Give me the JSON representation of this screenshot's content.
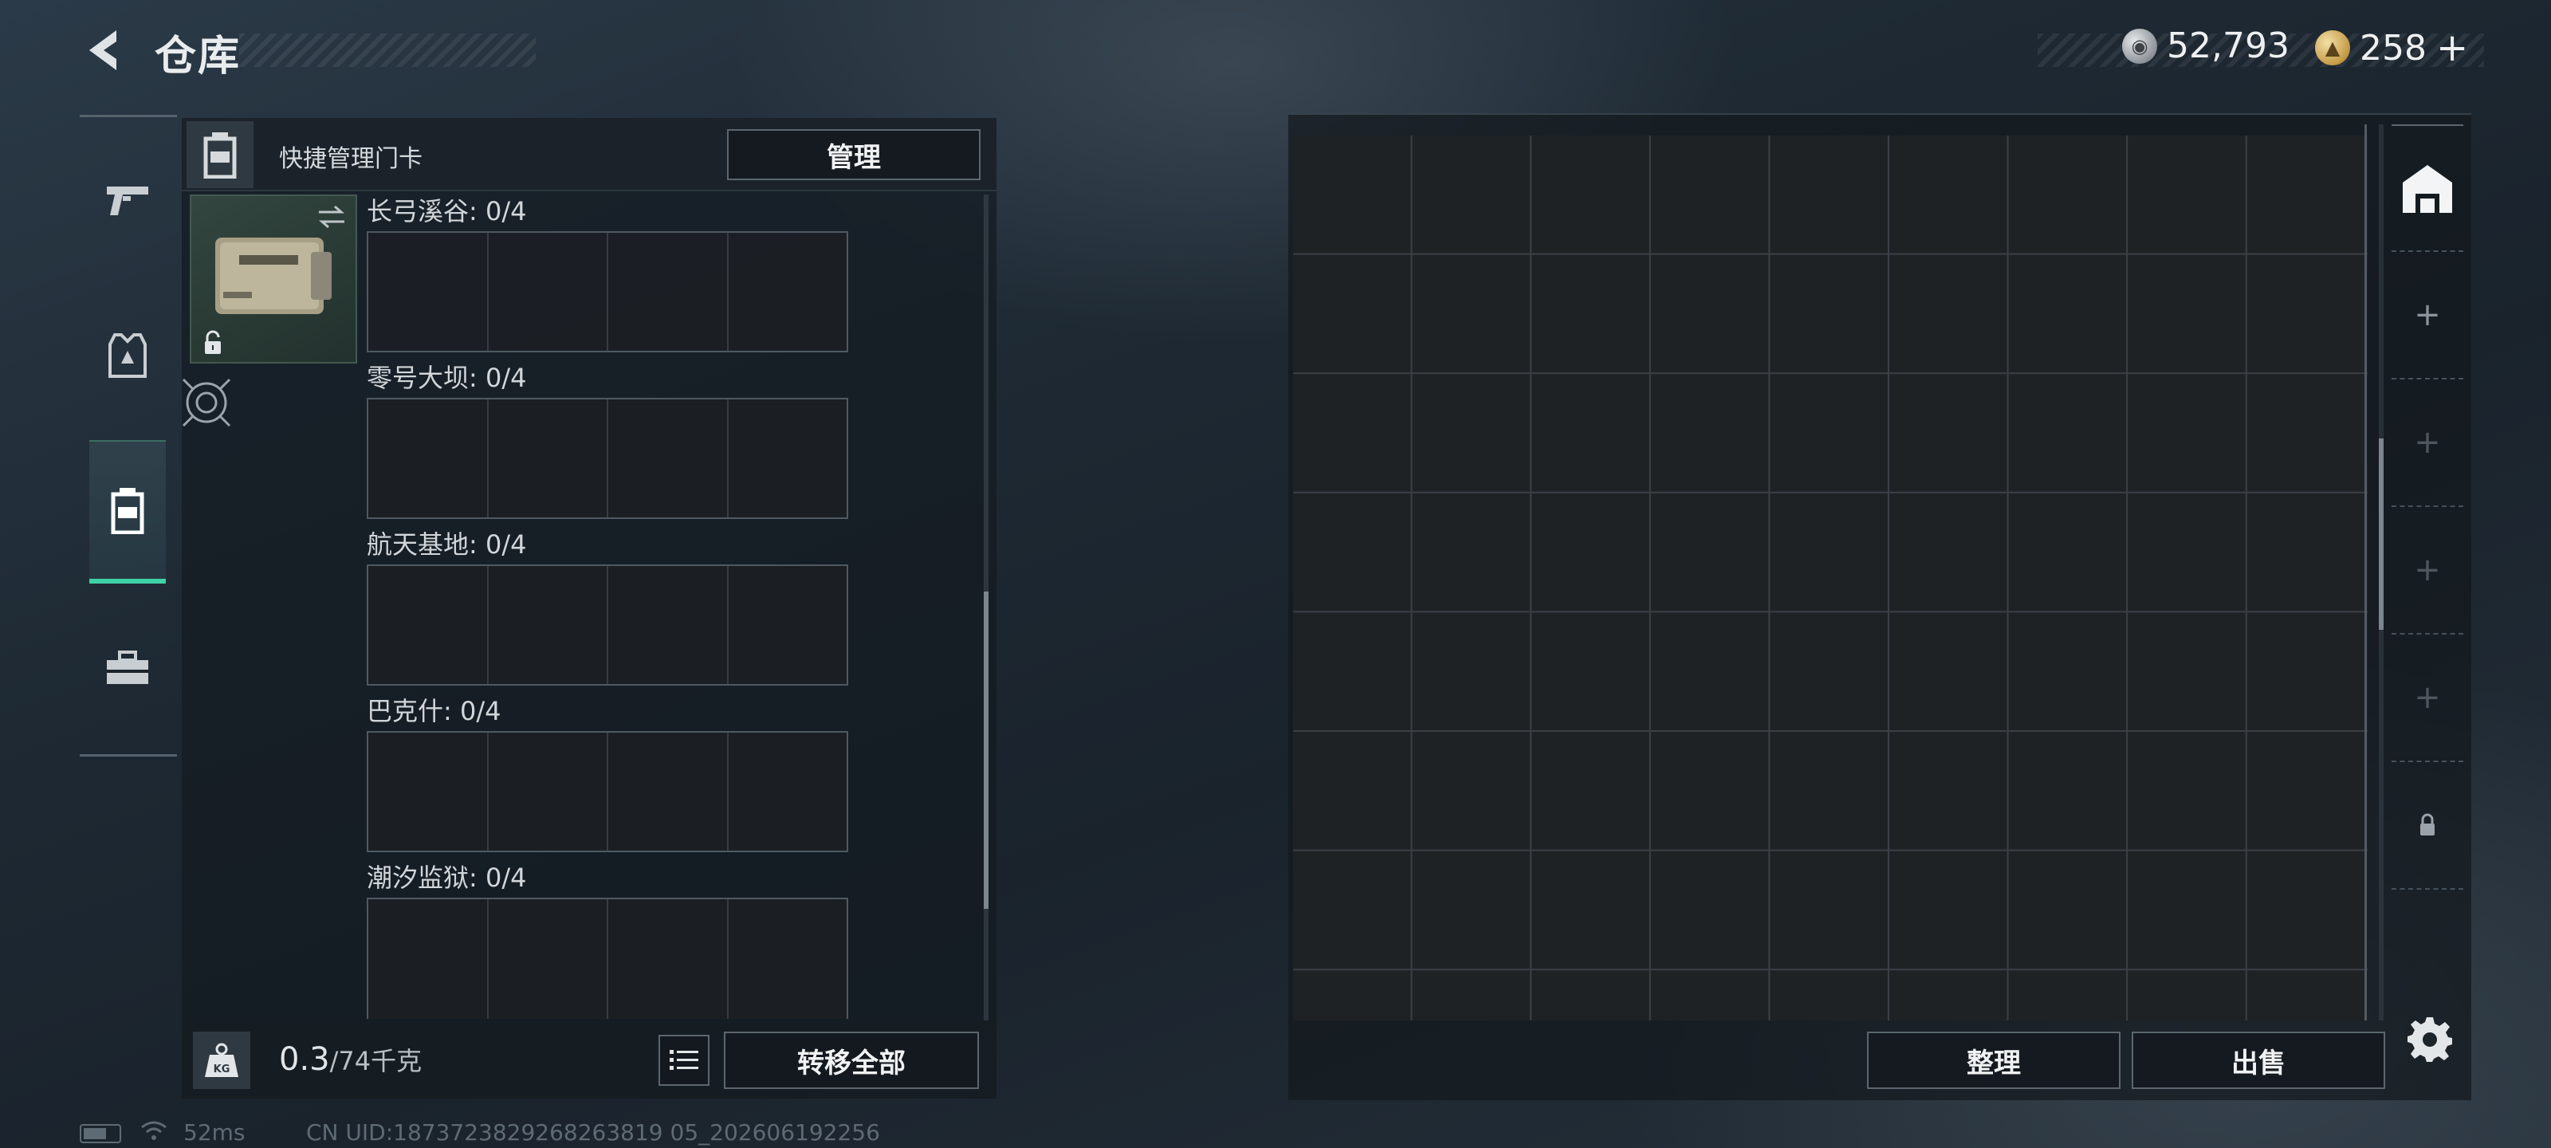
{
  "header": {
    "title": "仓库",
    "currency_silver": "52,793",
    "currency_gold": "258",
    "gold_add": "+"
  },
  "sidebar": {
    "items": [
      {
        "name": "weapons",
        "icon": "pistol-icon"
      },
      {
        "name": "gear",
        "icon": "armor-vest-icon"
      },
      {
        "name": "keycards",
        "icon": "keycard-holder-icon",
        "active": true
      },
      {
        "name": "misc",
        "icon": "toolbox-icon"
      }
    ]
  },
  "left_panel": {
    "header_label": "快捷管理门卡",
    "manage_label": "管理",
    "zones": [
      {
        "label": "长弓溪谷: 0/4"
      },
      {
        "label": "零号大坝: 0/4"
      },
      {
        "label": "航天基地: 0/4"
      },
      {
        "label": "巴克什: 0/4"
      },
      {
        "label": "潮汐监狱: 0/4"
      }
    ],
    "weight_icon_label": "KG",
    "weight_current": "0.3",
    "weight_capacity": "/74千克",
    "transfer_all_label": "转移全部"
  },
  "warehouse": {
    "sort_label": "整理",
    "sell_label": "出售",
    "tabs": [
      "warehouse-icon",
      "plus",
      "plus",
      "plus",
      "plus",
      "lock-icon"
    ]
  },
  "status_bar": {
    "ping": "52ms",
    "uid": "CN UID:1873723829268263819 05_202606192256"
  },
  "colors": {
    "accent": "#3fd2a6",
    "panel": "#141b21",
    "grid_line": "#3a4046"
  }
}
